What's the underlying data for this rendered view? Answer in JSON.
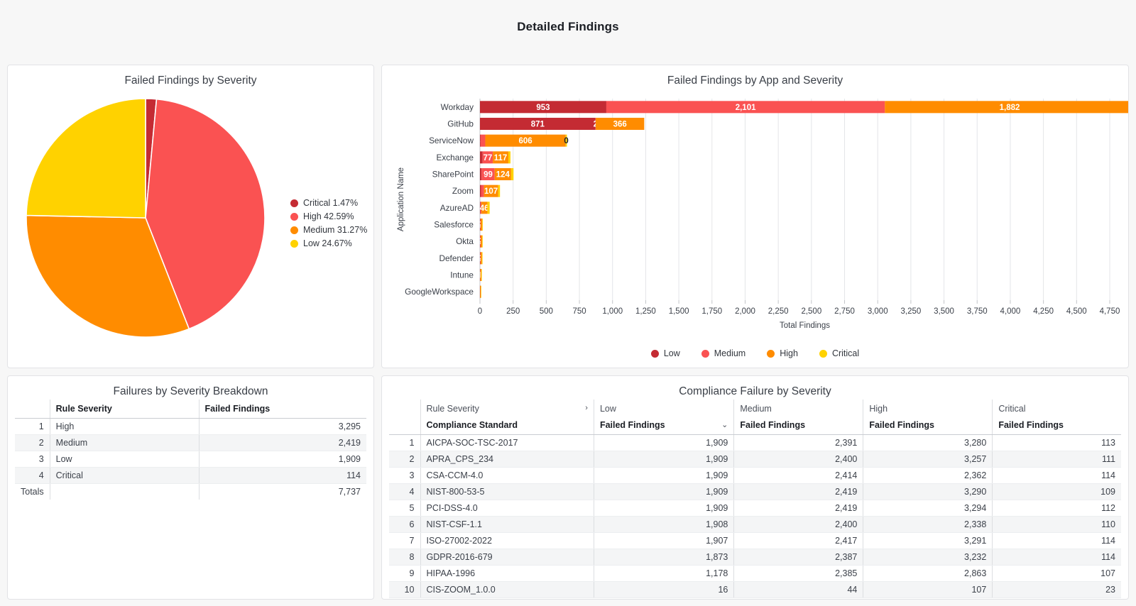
{
  "header": {
    "title": "Detailed Findings"
  },
  "colors": {
    "critical": "#ffd200",
    "high": "#ff8c00",
    "medium": "#fa5252",
    "low": "#c42b33",
    "dark_red": "#c42b33",
    "salmon": "#fa5252",
    "orange": "#ff8c00",
    "yellow": "#ffd200"
  },
  "pie_panel": {
    "title": "Failed Findings by Severity",
    "legend": [
      {
        "label": "Critical 1.47%",
        "color": "#c42b33"
      },
      {
        "label": "High 42.59%",
        "color": "#fa5252"
      },
      {
        "label": "Medium 31.27%",
        "color": "#ff8c00"
      },
      {
        "label": "Low 24.67%",
        "color": "#ffd200"
      }
    ]
  },
  "bar_panel": {
    "title": "Failed Findings by App and Severity",
    "legend": [
      {
        "label": "Low",
        "color": "#c42b33"
      },
      {
        "label": "Medium",
        "color": "#fa5252"
      },
      {
        "label": "High",
        "color": "#ff8c00"
      },
      {
        "label": "Critical",
        "color": "#ffd200"
      }
    ]
  },
  "left_table": {
    "title": "Failures by Severity Breakdown",
    "columns": [
      "",
      "Rule Severity",
      "Failed Findings"
    ],
    "rows": [
      {
        "idx": "1",
        "severity": "High",
        "findings": "3,295"
      },
      {
        "idx": "2",
        "severity": "Medium",
        "findings": "2,419"
      },
      {
        "idx": "3",
        "severity": "Low",
        "findings": "1,909"
      },
      {
        "idx": "4",
        "severity": "Critical",
        "findings": "114"
      }
    ],
    "totals_label": "Totals",
    "totals_value": "7,737"
  },
  "right_table": {
    "title": "Compliance Failure by Severity",
    "group_header_label": "Rule Severity",
    "group_expander": "›",
    "severity_groups": [
      "Low",
      "Medium",
      "High",
      "Critical"
    ],
    "standard_column": "Compliance Standard",
    "sub_column": "Failed Findings",
    "sort_indicator": "⌄",
    "rows": [
      {
        "idx": "1",
        "standard": "AICPA-SOC-TSC-2017",
        "low": "1,909",
        "medium": "2,391",
        "high": "3,280",
        "critical": "113"
      },
      {
        "idx": "2",
        "standard": "APRA_CPS_234",
        "low": "1,909",
        "medium": "2,400",
        "high": "3,257",
        "critical": "111"
      },
      {
        "idx": "3",
        "standard": "CSA-CCM-4.0",
        "low": "1,909",
        "medium": "2,414",
        "high": "2,362",
        "critical": "114"
      },
      {
        "idx": "4",
        "standard": "NIST-800-53-5",
        "low": "1,909",
        "medium": "2,419",
        "high": "3,290",
        "critical": "109"
      },
      {
        "idx": "5",
        "standard": "PCI-DSS-4.0",
        "low": "1,909",
        "medium": "2,419",
        "high": "3,294",
        "critical": "112"
      },
      {
        "idx": "6",
        "standard": "NIST-CSF-1.1",
        "low": "1,908",
        "medium": "2,400",
        "high": "2,338",
        "critical": "110"
      },
      {
        "idx": "7",
        "standard": "ISO-27002-2022",
        "low": "1,907",
        "medium": "2,417",
        "high": "3,291",
        "critical": "114"
      },
      {
        "idx": "8",
        "standard": "GDPR-2016-679",
        "low": "1,873",
        "medium": "2,387",
        "high": "3,232",
        "critical": "114"
      },
      {
        "idx": "9",
        "standard": "HIPAA-1996",
        "low": "1,178",
        "medium": "2,385",
        "high": "2,863",
        "critical": "107"
      },
      {
        "idx": "10",
        "standard": "CIS-ZOOM_1.0.0",
        "low": "16",
        "medium": "44",
        "high": "107",
        "critical": "23"
      }
    ]
  },
  "chart_data": [
    {
      "type": "pie",
      "title": "Failed Findings by Severity",
      "categories": [
        "Critical",
        "High",
        "Medium",
        "Low"
      ],
      "values": [
        1.47,
        42.59,
        31.27,
        24.67
      ],
      "value_unit": "percent",
      "colors": [
        "#c42b33",
        "#fa5252",
        "#ff8c00",
        "#ffd200"
      ],
      "legend_position": "right",
      "start_angle_deg": -90,
      "direction": "clockwise"
    },
    {
      "type": "bar",
      "orientation": "horizontal",
      "stacked": true,
      "title": "Failed Findings by App and Severity",
      "xlabel": "Total Findings",
      "ylabel": "Application Name",
      "xlim": [
        0,
        4900
      ],
      "xticks": [
        0,
        250,
        500,
        750,
        1000,
        1250,
        1500,
        1750,
        2000,
        2250,
        2500,
        2750,
        3000,
        3250,
        3500,
        3750,
        4000,
        4250,
        4500,
        4750
      ],
      "xtick_labels": [
        "0",
        "250",
        "500",
        "750",
        "1,000",
        "1,250",
        "1,500",
        "1,750",
        "2,000",
        "2,250",
        "2,500",
        "2,750",
        "3,000",
        "3,250",
        "3,500",
        "3,750",
        "4,000",
        "4,250",
        "4,500",
        "4,750"
      ],
      "grid": true,
      "legend_position": "bottom",
      "categories": [
        "Workday",
        "GitHub",
        "ServiceNow",
        "Exchange",
        "SharePoint",
        "Zoom",
        "AzureAD",
        "Salesforce",
        "Okta",
        "Defender",
        "Intune",
        "GoogleWorkspace"
      ],
      "series": [
        {
          "name": "Low",
          "color": "#c42b33",
          "values": [
            953,
            871,
            5,
            20,
            12,
            8,
            4,
            2,
            2,
            2,
            1,
            1
          ]
        },
        {
          "name": "Medium",
          "color": "#fa5252",
          "values": [
            2101,
            2,
            35,
            77,
            99,
            22,
            6,
            3,
            3,
            3,
            2,
            1
          ]
        },
        {
          "name": "High",
          "color": "#ff8c00",
          "values": [
            1882,
            366,
            606,
            117,
            124,
            107,
            46,
            12,
            11,
            10,
            7,
            4
          ]
        },
        {
          "name": "Critical",
          "color": "#ffd200",
          "values": [
            1,
            0,
            10,
            16,
            18,
            14,
            17,
            3,
            2,
            2,
            1,
            1
          ]
        }
      ],
      "bar_labels": {
        "Workday": [
          "953",
          "2,101",
          "1,882",
          "1"
        ],
        "GitHub": [
          "871",
          "2",
          "366",
          ""
        ],
        "ServiceNow": [
          "35",
          "",
          "606",
          "0"
        ],
        "Exchange": [
          "",
          "77",
          "117",
          ""
        ],
        "SharePoint": [
          "",
          "99",
          "124",
          ""
        ],
        "Zoom": [
          "",
          "",
          "107",
          ""
        ],
        "AzureAD": [
          "",
          "",
          "46",
          ""
        ],
        "Salesforce": [
          "",
          "2",
          "",
          ""
        ],
        "Okta": [
          "",
          "2",
          "",
          ""
        ],
        "Defender": [
          "",
          "2",
          "",
          ""
        ],
        "Intune": [
          "",
          "1",
          "",
          ""
        ],
        "GoogleWorkspace": [
          "",
          "",
          "",
          ""
        ]
      }
    },
    {
      "type": "table",
      "title": "Failures by Severity Breakdown",
      "columns": [
        "Rule Severity",
        "Failed Findings"
      ],
      "rows": [
        [
          "High",
          3295
        ],
        [
          "Medium",
          2419
        ],
        [
          "Low",
          1909
        ],
        [
          "Critical",
          114
        ]
      ],
      "totals": [
        "Totals",
        7737
      ]
    },
    {
      "type": "table",
      "title": "Compliance Failure by Severity",
      "columns": [
        "Compliance Standard",
        "Low",
        "Medium",
        "High",
        "Critical"
      ],
      "rows": [
        [
          "AICPA-SOC-TSC-2017",
          1909,
          2391,
          3280,
          113
        ],
        [
          "APRA_CPS_234",
          1909,
          2400,
          3257,
          111
        ],
        [
          "CSA-CCM-4.0",
          1909,
          2414,
          2362,
          114
        ],
        [
          "NIST-800-53-5",
          1909,
          2419,
          3290,
          109
        ],
        [
          "PCI-DSS-4.0",
          1909,
          2419,
          3294,
          112
        ],
        [
          "NIST-CSF-1.1",
          1908,
          2400,
          2338,
          110
        ],
        [
          "ISO-27002-2022",
          1907,
          2417,
          3291,
          114
        ],
        [
          "GDPR-2016-679",
          1873,
          2387,
          3232,
          114
        ],
        [
          "HIPAA-1996",
          1178,
          2385,
          2863,
          107
        ],
        [
          "CIS-ZOOM_1.0.0",
          16,
          44,
          107,
          23
        ]
      ]
    }
  ]
}
